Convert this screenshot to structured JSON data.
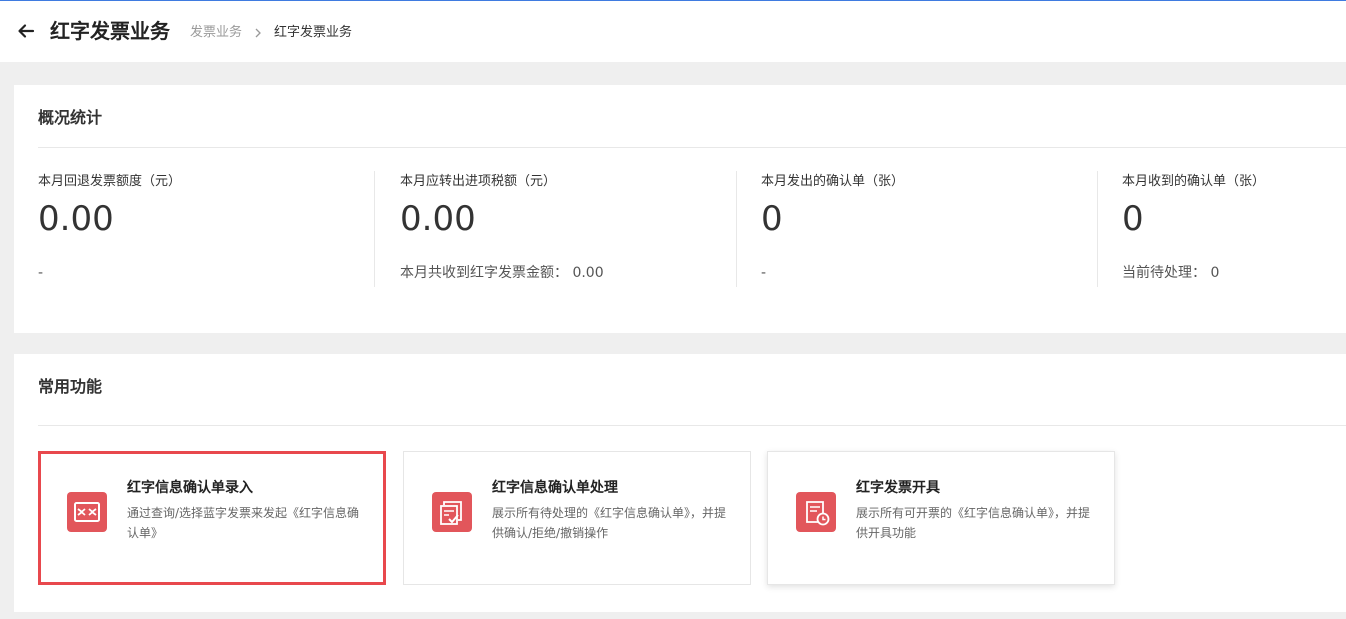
{
  "header": {
    "title": "红字发票业务",
    "breadcrumb": {
      "parent": "发票业务",
      "current": "红字发票业务"
    }
  },
  "overview": {
    "title": "概况统计",
    "stats": [
      {
        "label": "本月回退发票额度（元）",
        "value": "0.00",
        "sub": "-"
      },
      {
        "label": "本月应转出进项税额（元）",
        "value": "0.00",
        "sub": "本月共收到红字发票金额：  0.00"
      },
      {
        "label": "本月发出的确认单（张）",
        "value": "0",
        "sub": "-"
      },
      {
        "label": "本月收到的确认单（张）",
        "value": "0",
        "sub": "当前待处理：  0"
      }
    ]
  },
  "functions": {
    "title": "常用功能",
    "cards": [
      {
        "title": "红字信息确认单录入",
        "desc": "通过查询/选择蓝字发票来发起《红字信息确认单》",
        "icon": "arrows-inward-icon"
      },
      {
        "title": "红字信息确认单处理",
        "desc": "展示所有待处理的《红字信息确认单》，并提供确认/拒绝/撤销操作",
        "icon": "document-check-icon"
      },
      {
        "title": "红字发票开具",
        "desc": "展示所有可开票的《红字信息确认单》，并提供开具功能",
        "icon": "document-clock-icon"
      }
    ]
  },
  "colors": {
    "accent_line": "#3f7be0",
    "icon_bg": "#e2565b",
    "highlight": "#e8484d"
  }
}
